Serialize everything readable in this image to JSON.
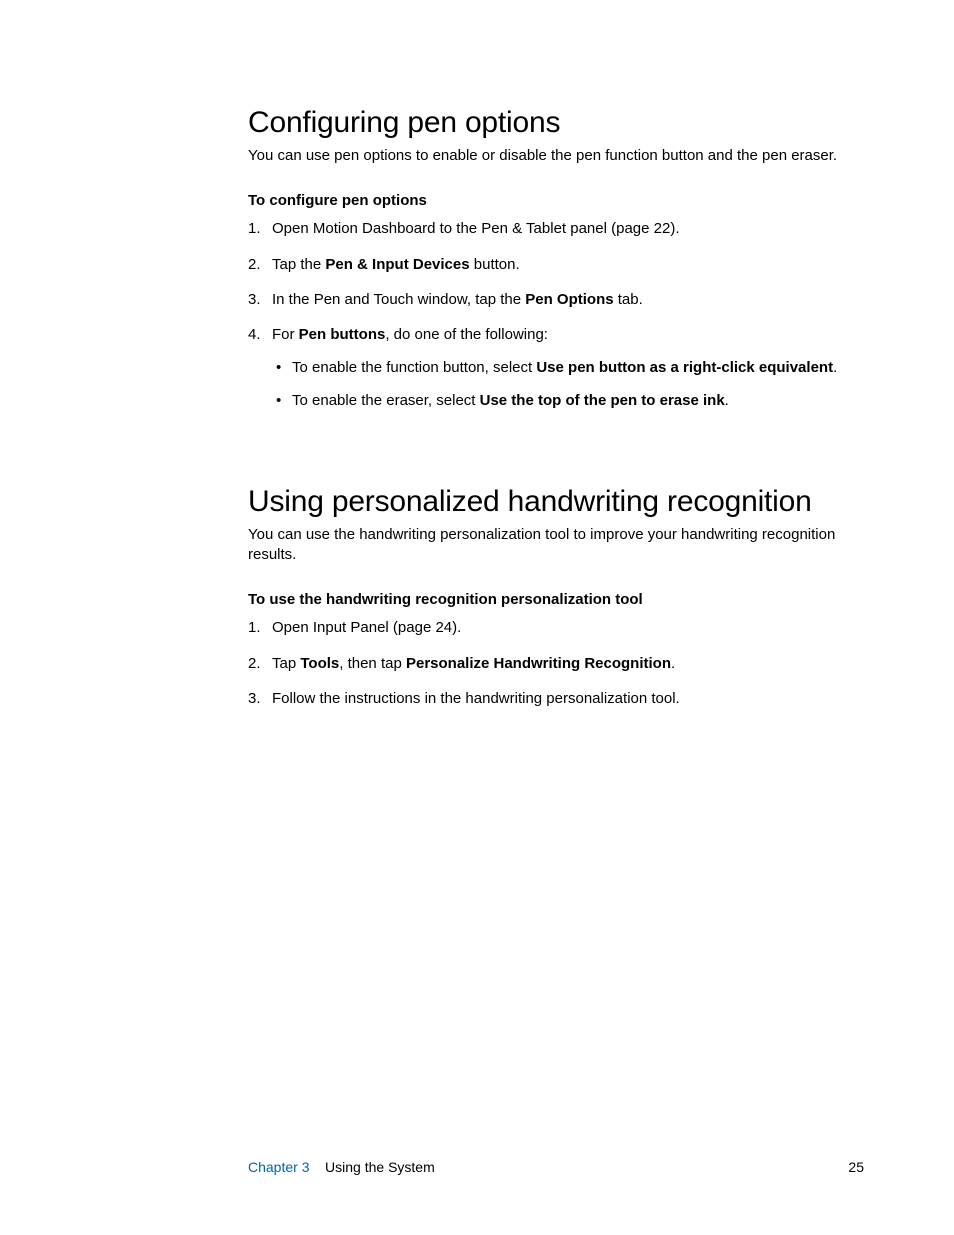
{
  "section1": {
    "heading": "Configuring pen options",
    "intro": "You can use pen options to enable or disable the pen function button and the pen eraser.",
    "subhead": "To configure pen options",
    "steps": {
      "s1": "Open Motion Dashboard to the Pen & Tablet panel (page 22).",
      "s2a": "Tap the ",
      "s2b": "Pen & Input Devices",
      "s2c": " button.",
      "s3a": "In the Pen and Touch window, tap the ",
      "s3b": "Pen Options",
      "s3c": " tab.",
      "s4a": "For ",
      "s4b": "Pen buttons",
      "s4c": ", do one of the following:",
      "s4_bullets": {
        "b1a": "To enable the function button, select ",
        "b1b": "Use pen button as a right-click equivalent",
        "b1c": ".",
        "b2a": "To enable the eraser, select ",
        "b2b": "Use the top of the pen to erase ink",
        "b2c": "."
      }
    }
  },
  "section2": {
    "heading": "Using personalized handwriting recognition",
    "intro": "You can use the handwriting personalization tool to improve your handwriting recognition results.",
    "subhead": "To use the handwriting recognition personalization tool",
    "steps": {
      "s1": "Open Input Panel (page 24).",
      "s2a": "Tap ",
      "s2b": "Tools",
      "s2c": ", then tap ",
      "s2d": "Personalize Handwriting Recognition",
      "s2e": ".",
      "s3": "Follow the instructions in the handwriting personalization tool."
    }
  },
  "footer": {
    "chapter": "Chapter 3",
    "title": "Using the System",
    "page": "25"
  }
}
